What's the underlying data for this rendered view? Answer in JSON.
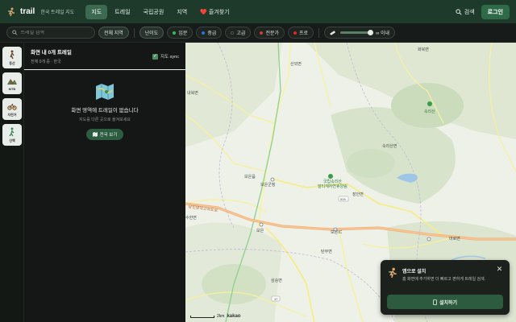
{
  "header": {
    "brand_name": "trail",
    "brand_sub": "한국 트레일 지도",
    "tabs": [
      {
        "label": "지도",
        "active": true
      },
      {
        "label": "트레일",
        "active": false
      },
      {
        "label": "국립공원",
        "active": false
      },
      {
        "label": "지역",
        "active": false
      },
      {
        "label": "❤️ 즐겨찾기",
        "active": false
      }
    ],
    "search_label": "검색",
    "login_label": "로그인"
  },
  "filters": {
    "search_placeholder": "트레일 검색",
    "all_regions": "전체 지역",
    "difficulty": "난이도",
    "levels": [
      {
        "label": "입문",
        "color": "#2fbf5b"
      },
      {
        "label": "중급",
        "color": "#2f6fe0"
      },
      {
        "label": "고급",
        "color": "#111111"
      },
      {
        "label": "전문가",
        "color": "#d33b3b"
      },
      {
        "label": "프로",
        "color": "#e02828"
      }
    ],
    "distance_label": "∞ 이내"
  },
  "rail": {
    "items": [
      {
        "label": "등산",
        "icon": "hiker-icon"
      },
      {
        "label": "MTB",
        "icon": "mtb-icon"
      },
      {
        "label": "자전거",
        "icon": "bicycle-icon"
      },
      {
        "label": "산책",
        "icon": "walker-icon"
      }
    ]
  },
  "panel": {
    "title": "화면 내 0개 트레일",
    "subtitle": "전체 0개 중 · 한국",
    "sync_label": "지도 sync",
    "sync_checked": true,
    "empty_title": "화면 영역에 트레일이 없습니다",
    "empty_sub": "지도를 다른 곳으로 옮겨보세요",
    "empty_button": "전국 보기"
  },
  "map": {
    "labels": [
      {
        "text": "화북면",
        "green": false
      },
      {
        "text": "산외면",
        "green": false
      },
      {
        "text": "내북면",
        "green": false
      },
      {
        "text": "속리산",
        "green": true
      },
      {
        "text": "속리산면",
        "green": false
      },
      {
        "text": "보은읍",
        "green": false
      },
      {
        "text": "보은군청",
        "green": false
      },
      {
        "text": "국립속리산\n말티재자연휴양림",
        "green": true
      },
      {
        "text": "장안면",
        "green": false
      },
      {
        "text": "수한면",
        "green": false
      },
      {
        "text": "보은",
        "green": false
      },
      {
        "text": "보은IC",
        "green": false
      },
      {
        "text": "마로면",
        "green": false
      },
      {
        "text": "탄부면",
        "green": false
      },
      {
        "text": "삼승면",
        "green": false
      },
      {
        "text": "당진영덕고속도로",
        "green": false
      },
      {
        "text": "505",
        "green": false
      },
      {
        "text": "37",
        "green": false
      }
    ],
    "scale_text": "2km",
    "attribution": "kakao"
  },
  "popup": {
    "title": "앱으로 설치",
    "desc": "홈 화면에 추가하면 더 빠르고 편하게 트레일 검색.",
    "button": "설치하기"
  }
}
